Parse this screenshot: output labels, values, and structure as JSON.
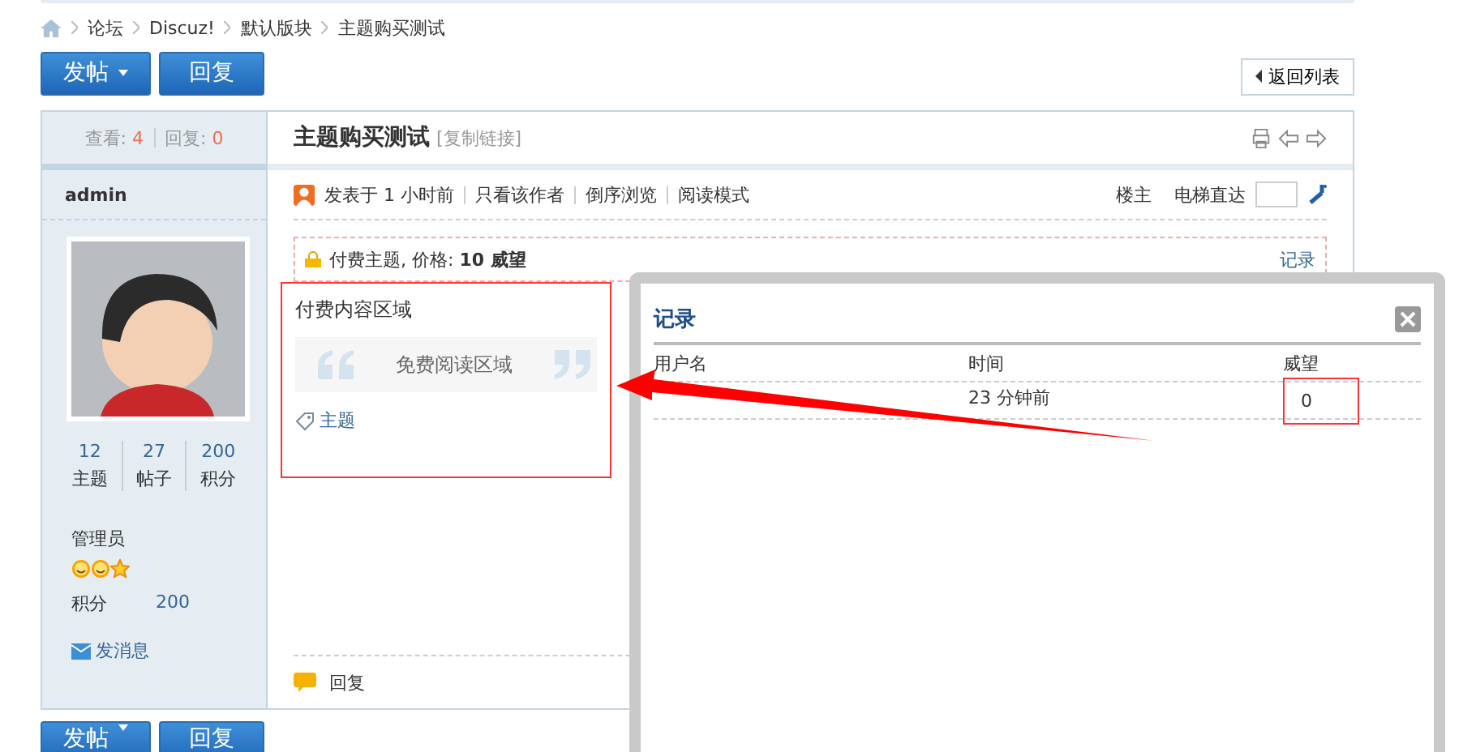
{
  "breadcrumb": [
    "论坛",
    "Discuz!",
    "默认版块",
    "主题购买测试"
  ],
  "toolbar": {
    "new_post": "发帖",
    "reply": "回复",
    "back": "返回列表"
  },
  "post": {
    "views_label": "查看:",
    "views": "4",
    "replies_label": "回复:",
    "replies": "0",
    "title": "主题购买测试",
    "copy_link": "[复制链接]",
    "author": "admin",
    "stats": [
      {
        "value": "12",
        "label": "主题"
      },
      {
        "value": "27",
        "label": "帖子"
      },
      {
        "value": "200",
        "label": "积分"
      }
    ],
    "group": "管理员",
    "points_label": "积分",
    "points": "200",
    "message": "发消息",
    "posted": "发表于 1 小时前",
    "links": [
      "只看该作者",
      "倒序浏览",
      "阅读模式"
    ],
    "floor": "楼主",
    "jump": "电梯直达",
    "paid_notice": "付费主题, 价格: **10 威望**",
    "record_link": "记录",
    "paid_heading": "付费内容区域",
    "free_quote": "免费阅读区域",
    "tag": "主题",
    "reply": "回复"
  },
  "bottom_toolbar": {
    "new_post": "发帖",
    "reply": "回复"
  },
  "dialog": {
    "title": "记录",
    "columns": [
      "用户名",
      "时间",
      "威望"
    ],
    "rows": [
      {
        "time": "23 分钟前",
        "value": "0"
      }
    ]
  }
}
